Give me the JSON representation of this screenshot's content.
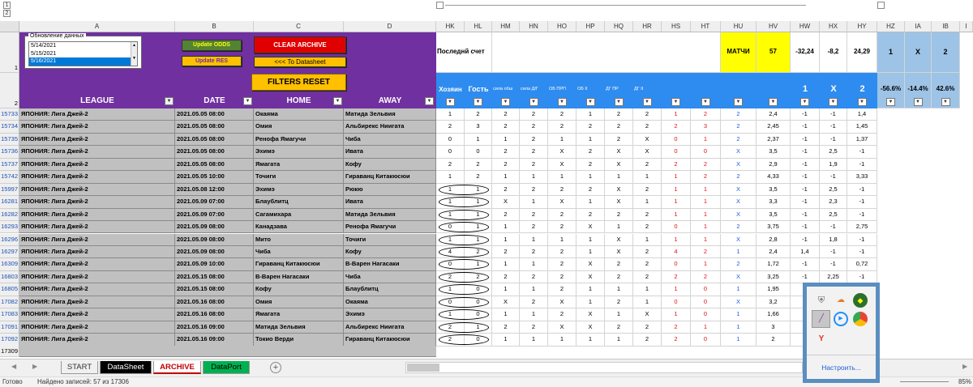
{
  "outline": {
    "level1": "1",
    "level2": "2"
  },
  "col_letters": [
    "A",
    "B",
    "C",
    "D",
    "HK",
    "HL",
    "HM",
    "HN",
    "HO",
    "HP",
    "HQ",
    "HR",
    "HS",
    "HT",
    "HU",
    "HV",
    "HW",
    "HX",
    "HY",
    "HZ",
    "IA",
    "IB",
    "I"
  ],
  "row1_num": "1",
  "row2_num": "2",
  "data_update": {
    "label": "Обновление данных",
    "items": [
      "5/14/2021",
      "5/15/2021",
      "5/16/2021"
    ],
    "selected": 2
  },
  "buttons": {
    "update_odds": "Update ODDS",
    "update_res": "Update RES",
    "clear_archive": "CLEAR ARCHIVE",
    "to_datasheet": "<<< To Datasheet",
    "filters_reset": "FILTERS RESET"
  },
  "headers": {
    "league": "LEAGUE",
    "date": "DATE",
    "home": "HOME",
    "away": "AWAY",
    "posledniy": "Последнй счет",
    "matchi": "МАТЧИ",
    "matchi_count": "57",
    "hw1": "-32,24",
    "hx1": "-8,2",
    "hy1": "24,29",
    "hz1": "1",
    "ia1": "X",
    "ib1": "2",
    "hosts": "Хозяин",
    "guest": "Гость",
    "sub": [
      "сила обш",
      "сила Д/Г",
      "ОБ ПРП",
      "ОБ II",
      "ДГ ПР",
      "ДГ II"
    ],
    "odds1": "1",
    "oddsX": "X",
    "odds2": "2",
    "hz2": "-56.6%",
    "ia2": "-14.4%",
    "ib2": "42.6%"
  },
  "rows": [
    {
      "id": "15733",
      "league": "ЯПОНИЯ: Лига Джей-2",
      "date": "2021.05.05 08:00",
      "home": "Окаяма",
      "away": "Матида Зельвия",
      "hk": "1",
      "hl": "2",
      "hm": "2",
      "hn": "2",
      "ho": "2",
      "hp": "1",
      "hq": "2",
      "hr": "2",
      "hs": "1",
      "ht": "2",
      "hu": "2",
      "hv": "2,4",
      "hw": "-1",
      "hx": "-1",
      "hy": "1,4",
      "red": [
        "hs",
        "ht"
      ],
      "blue": [
        "hu"
      ]
    },
    {
      "id": "15734",
      "league": "ЯПОНИЯ: Лига Джей-2",
      "date": "2021.05.05 08:00",
      "home": "Омия",
      "away": "Альбирекс Ниигата",
      "hk": "2",
      "hl": "3",
      "hm": "2",
      "hn": "2",
      "ho": "2",
      "hp": "2",
      "hq": "2",
      "hr": "2",
      "hs": "2",
      "ht": "3",
      "hu": "2",
      "hv": "2,45",
      "hw": "-1",
      "hx": "-1",
      "hy": "1,45",
      "red": [
        "hs",
        "ht"
      ],
      "blue": [
        "hu"
      ]
    },
    {
      "id": "15735",
      "league": "ЯПОНИЯ: Лига Джей-2",
      "date": "2021.05.05 08:00",
      "home": "Ренофа Ямагучи",
      "away": "Чиба",
      "hk": "0",
      "hl": "1",
      "hm": "1",
      "hn": "2",
      "ho": "1",
      "hp": "1",
      "hq": "2",
      "hr": "X",
      "hs": "0",
      "ht": "1",
      "hu": "2",
      "hv": "2,37",
      "hw": "-1",
      "hx": "-1",
      "hy": "1,37",
      "red": [
        "hs",
        "ht"
      ],
      "blue": [
        "hu"
      ]
    },
    {
      "id": "15736",
      "league": "ЯПОНИЯ: Лига Джей-2",
      "date": "2021.05.05 08:00",
      "home": "Эхимэ",
      "away": "Ивата",
      "hk": "0",
      "hl": "0",
      "hm": "2",
      "hn": "2",
      "ho": "X",
      "hp": "2",
      "hq": "X",
      "hr": "X",
      "hs": "0",
      "ht": "0",
      "hu": "X",
      "hv": "3,5",
      "hw": "-1",
      "hx": "2,5",
      "hy": "-1",
      "red": [
        "hs",
        "ht"
      ],
      "blue": [
        "hu"
      ]
    },
    {
      "id": "15737",
      "league": "ЯПОНИЯ: Лига Джей-2",
      "date": "2021.05.05 08:00",
      "home": "Ямагата",
      "away": "Кофу",
      "hk": "2",
      "hl": "2",
      "hm": "2",
      "hn": "2",
      "ho": "X",
      "hp": "2",
      "hq": "X",
      "hr": "2",
      "hs": "2",
      "ht": "2",
      "hu": "X",
      "hv": "2,9",
      "hw": "-1",
      "hx": "1,9",
      "hy": "-1",
      "red": [
        "hs",
        "ht"
      ],
      "blue": [
        "hu"
      ]
    },
    {
      "id": "15742",
      "league": "ЯПОНИЯ: Лига Джей-2",
      "date": "2021.05.05 10:00",
      "home": "Точиги",
      "away": "Гираванц Китакюсюи",
      "hk": "1",
      "hl": "2",
      "hm": "1",
      "hn": "1",
      "ho": "1",
      "hp": "1",
      "hq": "1",
      "hr": "1",
      "hs": "1",
      "ht": "2",
      "hu": "2",
      "hv": "4,33",
      "hw": "-1",
      "hx": "-1",
      "hy": "3,33",
      "red": [
        "hs",
        "ht"
      ],
      "blue": [
        "hu"
      ]
    },
    {
      "id": "15997",
      "league": "ЯПОНИЯ: Лига Джей-2",
      "date": "2021.05.08 12:00",
      "home": "Эхимэ",
      "away": "Рюкю",
      "hk": "1",
      "hl": "1",
      "hm": "2",
      "hn": "2",
      "ho": "2",
      "hp": "2",
      "hq": "X",
      "hr": "2",
      "hs": "1",
      "ht": "1",
      "hu": "X",
      "hv": "3,5",
      "hw": "-1",
      "hx": "2,5",
      "hy": "-1",
      "red": [
        "hs",
        "ht"
      ],
      "blue": [
        "hu"
      ]
    },
    {
      "id": "16281",
      "league": "ЯПОНИЯ: Лига Джей-2",
      "date": "2021.05.09 07:00",
      "home": "Блаублитц",
      "away": "Ивата",
      "hk": "1",
      "hl": "1",
      "hm": "X",
      "hn": "1",
      "ho": "X",
      "hp": "1",
      "hq": "X",
      "hr": "1",
      "hs": "1",
      "ht": "1",
      "hu": "X",
      "hv": "3,3",
      "hw": "-1",
      "hx": "2,3",
      "hy": "-1",
      "red": [
        "hs",
        "ht"
      ],
      "blue": [
        "hu"
      ]
    },
    {
      "id": "16282",
      "league": "ЯПОНИЯ: Лига Джей-2",
      "date": "2021.05.09 07:00",
      "home": "Сагамихара",
      "away": "Матида Зельвия",
      "hk": "1",
      "hl": "1",
      "hm": "2",
      "hn": "2",
      "ho": "2",
      "hp": "2",
      "hq": "2",
      "hr": "2",
      "hs": "1",
      "ht": "1",
      "hu": "X",
      "hv": "3,5",
      "hw": "-1",
      "hx": "2,5",
      "hy": "-1",
      "red": [
        "hs",
        "ht"
      ],
      "blue": [
        "hu"
      ]
    },
    {
      "id": "16293",
      "league": "ЯПОНИЯ: Лига Джей-2",
      "date": "2021.05.09 08:00",
      "home": "Канадзава",
      "away": "Ренофа Ямагучи",
      "hk": "0",
      "hl": "1",
      "hm": "1",
      "hn": "2",
      "ho": "2",
      "hp": "X",
      "hq": "1",
      "hr": "2",
      "hs": "0",
      "ht": "1",
      "hu": "2",
      "hv": "3,75",
      "hw": "-1",
      "hx": "-1",
      "hy": "2,75",
      "red": [
        "hs",
        "ht"
      ],
      "blue": [
        "hu"
      ]
    },
    {
      "id": "16296",
      "league": "ЯПОНИЯ: Лига Джей-2",
      "date": "2021.05.09 08:00",
      "home": "Мито",
      "away": "Точиги",
      "hk": "1",
      "hl": "1",
      "hm": "1",
      "hn": "1",
      "ho": "1",
      "hp": "1",
      "hq": "X",
      "hr": "1",
      "hs": "1",
      "ht": "1",
      "hu": "X",
      "hv": "2,8",
      "hw": "-1",
      "hx": "1,8",
      "hy": "-1",
      "red": [
        "hs",
        "ht"
      ],
      "blue": [
        "hu"
      ]
    },
    {
      "id": "16297",
      "league": "ЯПОНИЯ: Лига Джей-2",
      "date": "2021.05.09 08:00",
      "home": "Чиба",
      "away": "Кофу",
      "hk": "4",
      "hl": "2",
      "hm": "2",
      "hn": "2",
      "ho": "2",
      "hp": "1",
      "hq": "X",
      "hr": "2",
      "hs": "4",
      "ht": "2",
      "hu": "1",
      "hv": "2,4",
      "hw": "1,4",
      "hx": "-1",
      "hy": "-1",
      "red": [
        "hs",
        "ht"
      ],
      "blue": [
        "hu"
      ]
    },
    {
      "id": "16309",
      "league": "ЯПОНИЯ: Лига Джей-2",
      "date": "2021.05.09 10:00",
      "home": "Гираванц Китакюсюи",
      "away": "В-Варен Нагасаки",
      "hk": "0",
      "hl": "1",
      "hm": "1",
      "hn": "1",
      "ho": "2",
      "hp": "X",
      "hq": "2",
      "hr": "2",
      "hs": "0",
      "ht": "1",
      "hu": "2",
      "hv": "1,72",
      "hw": "-1",
      "hx": "-1",
      "hy": "0,72",
      "red": [
        "hs",
        "ht"
      ],
      "blue": [
        "hu"
      ]
    },
    {
      "id": "16803",
      "league": "ЯПОНИЯ: Лига Джей-2",
      "date": "2021.05.15 08:00",
      "home": "В-Варен Нагасаки",
      "away": "Чиба",
      "hk": "2",
      "hl": "2",
      "hm": "2",
      "hn": "2",
      "ho": "2",
      "hp": "X",
      "hq": "2",
      "hr": "2",
      "hs": "2",
      "ht": "2",
      "hu": "X",
      "hv": "3,25",
      "hw": "-1",
      "hx": "2,25",
      "hy": "-1",
      "red": [
        "hs",
        "ht"
      ],
      "blue": [
        "hu"
      ]
    },
    {
      "id": "16805",
      "league": "ЯПОНИЯ: Лига Джей-2",
      "date": "2021.05.15 08:00",
      "home": "Кофу",
      "away": "Блаублитц",
      "hk": "1",
      "hl": "0",
      "hm": "1",
      "hn": "1",
      "ho": "2",
      "hp": "1",
      "hq": "1",
      "hr": "1",
      "hs": "1",
      "ht": "0",
      "hu": "1",
      "hv": "1,95",
      "hw": "0",
      "hx": "",
      "hy": "",
      "red": [
        "hs",
        "ht"
      ],
      "blue": [
        "hu"
      ]
    },
    {
      "id": "17082",
      "league": "ЯПОНИЯ: Лига Джей-2",
      "date": "2021.05.16 08:00",
      "home": "Омия",
      "away": "Окаяма",
      "hk": "0",
      "hl": "0",
      "hm": "X",
      "hn": "2",
      "ho": "X",
      "hp": "1",
      "hq": "2",
      "hr": "1",
      "hs": "0",
      "ht": "0",
      "hu": "X",
      "hv": "3,2",
      "hw": "",
      "hx": "",
      "hy": "",
      "red": [
        "hs",
        "ht"
      ],
      "blue": [
        "hu"
      ]
    },
    {
      "id": "17083",
      "league": "ЯПОНИЯ: Лига Джей-2",
      "date": "2021.05.16 08:00",
      "home": "Ямагата",
      "away": "Эхимэ",
      "hk": "1",
      "hl": "0",
      "hm": "1",
      "hn": "1",
      "ho": "2",
      "hp": "X",
      "hq": "1",
      "hr": "X",
      "hs": "1",
      "ht": "0",
      "hu": "1",
      "hv": "1,66",
      "hw": "0",
      "hx": "",
      "hy": "",
      "red": [
        "hs",
        "ht"
      ],
      "blue": [
        "hu"
      ]
    },
    {
      "id": "17091",
      "league": "ЯПОНИЯ: Лига Джей-2",
      "date": "2021.05.16 09:00",
      "home": "Матида Зельвия",
      "away": "Альбирекс Ниигата",
      "hk": "2",
      "hl": "1",
      "hm": "2",
      "hn": "2",
      "ho": "X",
      "hp": "X",
      "hq": "2",
      "hr": "2",
      "hs": "2",
      "ht": "1",
      "hu": "1",
      "hv": "3",
      "hw": "",
      "hx": "",
      "hy": "",
      "red": [
        "hs",
        "ht"
      ],
      "blue": [
        "hu"
      ]
    },
    {
      "id": "17092",
      "league": "ЯПОНИЯ: Лига Джей-2",
      "date": "2021.05.16 09:00",
      "home": "Токио Верди",
      "away": "Гираванц Китакюсюи",
      "hk": "2",
      "hl": "0",
      "hm": "1",
      "hn": "1",
      "ho": "1",
      "hp": "1",
      "hq": "1",
      "hr": "2",
      "hs": "2",
      "ht": "0",
      "hu": "1",
      "hv": "2",
      "hw": "",
      "hx": "",
      "hy": "",
      "red": [
        "hs",
        "ht"
      ],
      "blue": [
        "hu"
      ]
    }
  ],
  "last_row": "17309",
  "tabs": [
    "START",
    "DataSheet",
    "ARCHIVE",
    "DataPort"
  ],
  "status": {
    "ready": "Готово",
    "found": "Найдено записей: 57 из 17306",
    "zoom": "85%"
  },
  "tray": {
    "customize": "Настроить..."
  }
}
